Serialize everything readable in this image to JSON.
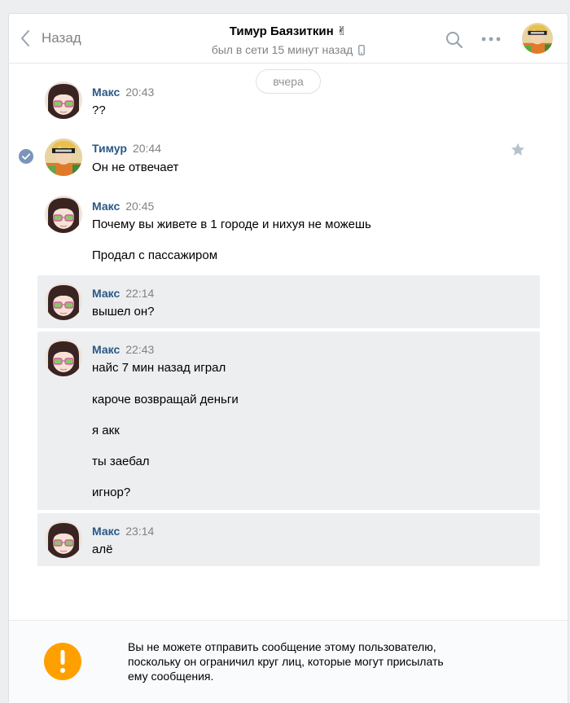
{
  "header": {
    "back_label": "Назад",
    "peer_name": "Тимур Баязиткин",
    "peer_emoji": "✌",
    "peer_status": "был в сети 15 минут назад"
  },
  "date_separator": "вчера",
  "messages": [
    {
      "author": "Макс",
      "time": "20:43",
      "lines": [
        "??"
      ]
    },
    {
      "author": "Тимур",
      "time": "20:44",
      "lines": [
        "Он не отвечает"
      ]
    },
    {
      "author": "Макс",
      "time": "20:45",
      "lines": [
        "Почему вы живете в 1 городе и нихуя не можешь",
        "Продал с пассажиром"
      ]
    },
    {
      "author": "Макс",
      "time": "22:14",
      "lines": [
        "вышел он?"
      ],
      "unread": true
    },
    {
      "author": "Макс",
      "time": "22:43",
      "lines": [
        "найс 7 мин назад играл",
        "кароче возвращай деньги",
        "я акк",
        "ты заебал",
        "игнор?"
      ],
      "unread": true
    },
    {
      "author": "Макс",
      "time": "23:14",
      "lines": [
        "алё"
      ],
      "unread": true
    }
  ],
  "footer": {
    "notice_lines": [
      "Вы не можете отправить сообщение этому пользователю,",
      "поскольку он ограничил круг лиц, которые могут присылать",
      "ему сообщения."
    ]
  },
  "colors": {
    "author_link": "#2a5885",
    "unread_bg": "#edeef0",
    "selected_check": "#7a95b8",
    "warning": "#ffa000"
  },
  "icons": {
    "back": "chevron-left-icon",
    "search": "search-icon",
    "more": "more-dots-icon",
    "phone": "mobile-phone-icon",
    "check": "check-circle-icon",
    "star": "star-icon",
    "warning": "warning-icon"
  }
}
